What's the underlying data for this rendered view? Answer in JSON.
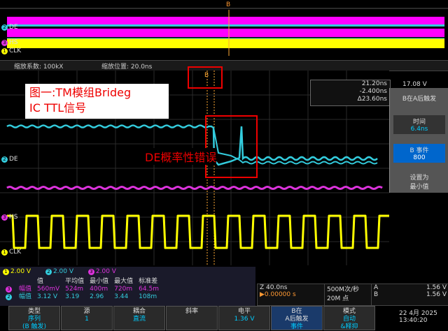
{
  "colors": {
    "ch1": "#ffff00",
    "ch2": "#33ccdd",
    "ch3": "#dd33dd",
    "accent": "#ff0000",
    "ch4": "#2288ff"
  },
  "overview": {
    "trigger_marker": "B",
    "channels": [
      {
        "id": "2",
        "name": "DE"
      },
      {
        "id": "3",
        "name": "HS"
      },
      {
        "id": "1",
        "name": "CLK"
      }
    ]
  },
  "zoom_bar": {
    "factor": "缩放系数: 100kX",
    "position": "缩放位置: 20.0ns"
  },
  "grid_marker": "B",
  "annotation": {
    "line1": "图一:TM模组Brideg",
    "line2": "IC TTL信号"
  },
  "de_error_label": "DE概率性错误",
  "cursor_readout": {
    "a": "21.20ns",
    "b": "-2.400ns",
    "delta": "Δ23.60ns",
    "top_right": "17.08 V"
  },
  "right_panel": {
    "title": "B在A后触发",
    "time_label": "时间",
    "time_value": "6.4ns",
    "event_label": "B 事件",
    "event_value": "800",
    "set_min": "设置为\n最小值"
  },
  "traces": [
    {
      "id": "2",
      "name": "DE"
    },
    {
      "id": "3",
      "name": "HS"
    },
    {
      "id": "1",
      "name": "CLK"
    }
  ],
  "meas": {
    "ch_scales": [
      {
        "id": "1",
        "value": "2.00 V"
      },
      {
        "id": "2",
        "value": "2.00 V"
      },
      {
        "id": "3",
        "value": "2.00 V"
      }
    ],
    "headers": [
      "值",
      "平均值",
      "最小值",
      "最大值",
      "标准差"
    ],
    "rows": [
      {
        "ch": "3",
        "label": "幅值",
        "values": [
          "560mV",
          "524m",
          "400m",
          "720m",
          "64.5m"
        ]
      },
      {
        "ch": "2",
        "label": "幅值",
        "values": [
          "3.12 V",
          "3.19",
          "2.96",
          "3.44",
          "108m"
        ]
      }
    ]
  },
  "timebase": {
    "zoom": "Z 40.0ns",
    "delay": "▶0.00000 s"
  },
  "acq": {
    "rate": "500M次/秒",
    "points": "20M 点"
  },
  "trig_info": {
    "a_src": "A",
    "a_val": "1.56 V",
    "b_src": "B",
    "b_val": "1.56 V"
  },
  "buttons": [
    {
      "label": "类型",
      "value": "序列\n(B 触发)"
    },
    {
      "label": "源",
      "value": "1"
    },
    {
      "label": "耦合",
      "value": "直流"
    },
    {
      "label": "斜率",
      "value": ""
    },
    {
      "label": "电平",
      "value": "1.36 V"
    },
    {
      "label": "B在\nA后触发",
      "value": "事件"
    },
    {
      "label": "模式",
      "value": "自动\n&释抑"
    }
  ],
  "datetime": {
    "date": "22 4月 2025",
    "time": "13:40:20"
  }
}
